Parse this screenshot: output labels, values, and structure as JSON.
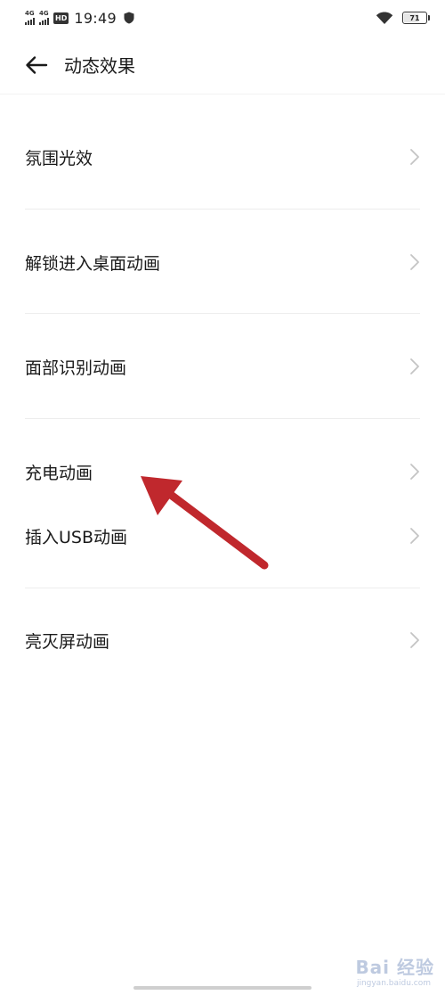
{
  "status_bar": {
    "sim1_label": "4G",
    "sim2_label": "4G",
    "hd_label": "HD",
    "time": "19:49",
    "battery_level": "71",
    "battery_percent": 71
  },
  "header": {
    "title": "动态效果"
  },
  "items": [
    {
      "label": "氛围光效"
    },
    {
      "label": "解锁进入桌面动画"
    },
    {
      "label": "面部识别动画"
    },
    {
      "label": "充电动画"
    },
    {
      "label": "插入USB动画"
    },
    {
      "label": "亮灭屏动画"
    }
  ],
  "annotation": {
    "color": "#c0282d"
  },
  "watermark": {
    "text": "Bai 经验",
    "sub": "jingyan.baidu.com"
  }
}
